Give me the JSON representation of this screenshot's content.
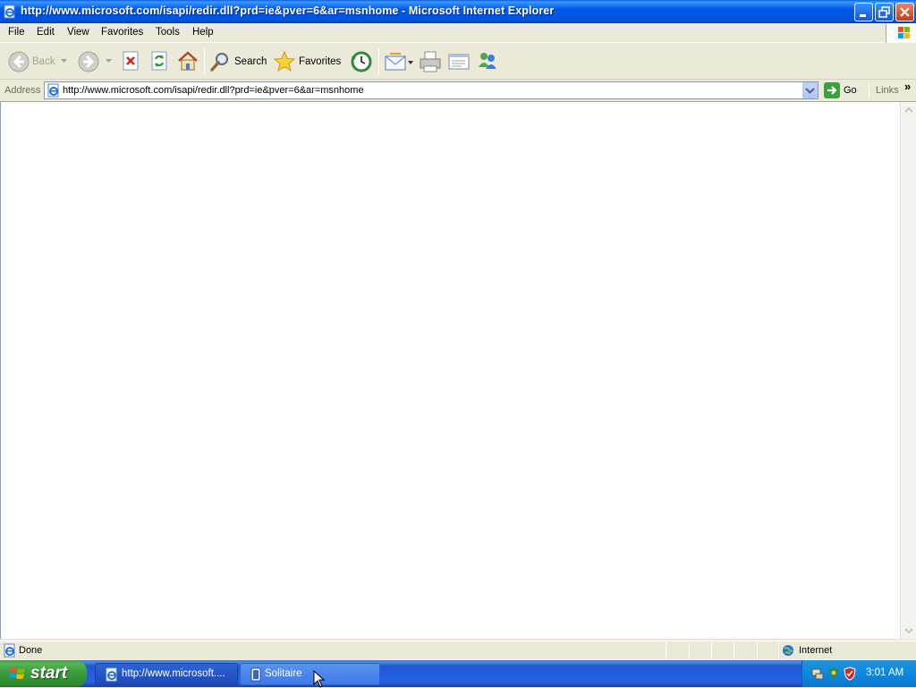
{
  "window": {
    "title": "http://www.microsoft.com/isapi/redir.dll?prd=ie&pver=6&ar=msnhome - Microsoft Internet Explorer"
  },
  "menu": {
    "items": [
      "File",
      "Edit",
      "View",
      "Favorites",
      "Tools",
      "Help"
    ]
  },
  "toolbar": {
    "back_label": "Back",
    "search_label": "Search",
    "favorites_label": "Favorites"
  },
  "address": {
    "label": "Address",
    "url": "http://www.microsoft.com/isapi/redir.dll?prd=ie&pver=6&ar=msnhome",
    "go_label": "Go",
    "links_label": "Links",
    "links_chevron": "»"
  },
  "status": {
    "text": "Done",
    "zone": "Internet"
  },
  "taskbar": {
    "start_label": "start",
    "tasks": [
      "http://www.microsoft....",
      "Solitaire"
    ],
    "clock": "3:01 AM"
  },
  "colors": {
    "titlebar": "#0054E3",
    "taskbar": "#245EDC",
    "start": "#3C9A3C",
    "face": "#ECE9D8"
  }
}
